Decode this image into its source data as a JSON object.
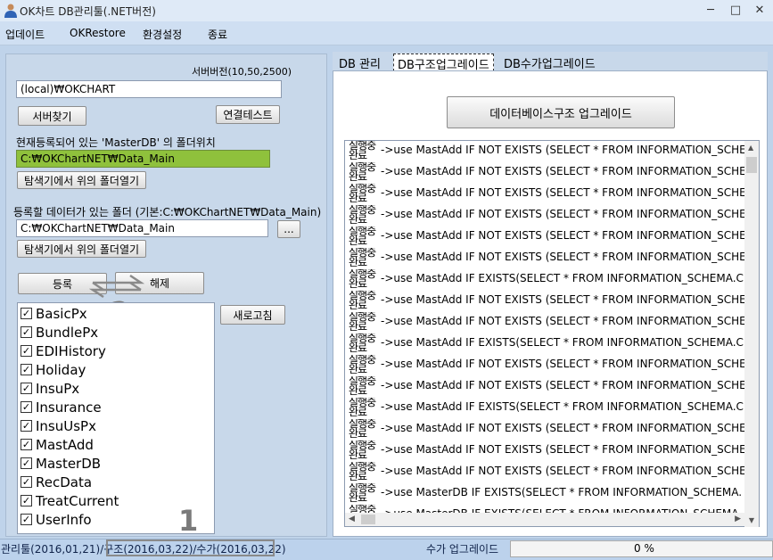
{
  "window": {
    "title": "OK차트 DB관리툴(.NET버전)",
    "minimize": "─",
    "maximize": "□",
    "close": "✕"
  },
  "menu": [
    "업데이트",
    "OKRestore",
    "환경설정",
    "종료"
  ],
  "left": {
    "server_version": "서버버전(10,50,2500)",
    "server_input": "(local)₩OKCHART",
    "find_server": "서버찾기",
    "test_connection": "연결테스트",
    "master_label": "현재등록되어 있는 'MasterDB' 의 폴더위치",
    "master_path": "C:₩OKChartNET₩Data_Main",
    "open_folder_1": "탐색기에서 위의 폴더열기",
    "data_folder_label": "등록할 데이터가 있는 폴더 (기본:C:₩OKChartNET₩Data_Main)",
    "data_folder_path": "C:₩OKChartNET₩Data_Main",
    "browse": "...",
    "open_folder_2": "탐색기에서 위의 폴더열기",
    "register": "등록",
    "unregister": "해제",
    "refresh": "새로고침",
    "annotation_2": "2",
    "annotation_1": "1",
    "check_mark": "✓",
    "databases": [
      "BasicPx",
      "BundlePx",
      "EDIHistory",
      "Holiday",
      "InsuPx",
      "Insurance",
      "InsuUsPx",
      "MastAdd",
      "MasterDB",
      "RecData",
      "TreatCurrent",
      "UserInfo"
    ]
  },
  "tabs": [
    "DB 관리",
    "DB구조업그레이드",
    "DB수가업그레이드"
  ],
  "right": {
    "upgrade_button": "데이터베이스구조 업그레이드",
    "log_prefix": [
      "실행중",
      "완료"
    ],
    "log": [
      "->use MastAdd IF NOT EXISTS (SELECT * FROM INFORMATION_SCHEMA",
      "->use MastAdd IF NOT EXISTS (SELECT * FROM INFORMATION_SCHEMA",
      "->use MastAdd IF NOT EXISTS (SELECT * FROM INFORMATION_SCHEMA",
      "->use MastAdd IF NOT EXISTS (SELECT * FROM INFORMATION_SCHEMA",
      "->use MastAdd IF NOT EXISTS (SELECT * FROM INFORMATION_SCHEMA",
      "->use MastAdd IF NOT EXISTS (SELECT * FROM INFORMATION_SCHEMA",
      "->use MastAdd IF EXISTS(SELECT * FROM INFORMATION_SCHEMA.C",
      "->use MastAdd IF NOT EXISTS (SELECT * FROM INFORMATION_SCHEMA",
      "->use MastAdd IF NOT EXISTS (SELECT * FROM INFORMATION_SCHEMA",
      "->use MastAdd IF EXISTS(SELECT * FROM INFORMATION_SCHEMA.C",
      "->use MastAdd IF NOT EXISTS (SELECT * FROM INFORMATION_SCHEMA",
      "->use MastAdd IF NOT EXISTS (SELECT * FROM INFORMATION_SCHEMA",
      "->use MastAdd IF EXISTS(SELECT * FROM INFORMATION_SCHEMA.C",
      "->use MastAdd IF NOT EXISTS (SELECT * FROM INFORMATION_SCHEMA",
      "->use MastAdd IF NOT EXISTS (SELECT * FROM INFORMATION_SCHEMA",
      "->use MastAdd IF NOT EXISTS (SELECT * FROM INFORMATION_SCHEMA",
      "->use MasterDB IF EXISTS(SELECT * FROM INFORMATION_SCHEMA.",
      "->use MasterDB IF EXISTS(SELECT * FROM INFORMATION_SCHEMA."
    ]
  },
  "status": {
    "left_text": "관리툴(2016,01,21)/구조(2016,03,22)/수가(2016,03,22)",
    "middle_text": "수가 업그레이드",
    "progress_text": "0 %"
  }
}
